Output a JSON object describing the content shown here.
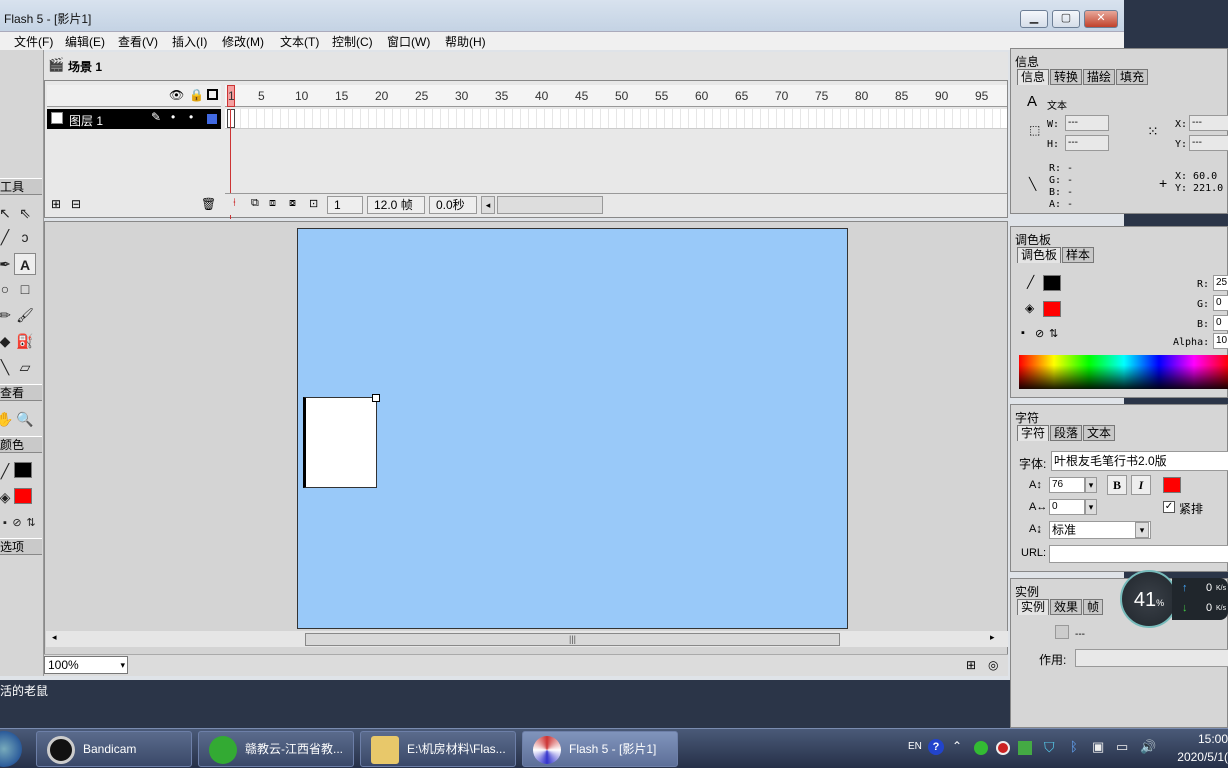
{
  "window": {
    "title": "Flash 5 - [影片1]"
  },
  "menu": [
    "文件(F)",
    "编辑(E)",
    "查看(V)",
    "插入(I)",
    "修改(M)",
    "文本(T)",
    "控制(C)",
    "窗口(W)",
    "帮助(H)"
  ],
  "scene": {
    "label": "场景 1"
  },
  "toolbox": {
    "tools_head": "工具",
    "view_head": "查看",
    "colors_head": "颜色",
    "options_head": "选项"
  },
  "timeline": {
    "layer_name": "图层 1",
    "ruler": [
      "1",
      "5",
      "10",
      "15",
      "20",
      "25",
      "30",
      "35",
      "40",
      "45",
      "50",
      "55",
      "60",
      "65",
      "70",
      "75",
      "80",
      "85",
      "90",
      "95"
    ],
    "current_frame": "1",
    "fps": "12.0 帧",
    "time": "0.0秒"
  },
  "status": {
    "zoom": "100%",
    "desktop_text": "活的老鼠"
  },
  "info_panel": {
    "title": "信息",
    "tabs": [
      "信息",
      "转换",
      "描绘",
      "填充"
    ],
    "type_label": "文本",
    "w_label": "W:",
    "h_label": "H:",
    "x_label": "X:",
    "y_label": "Y:",
    "w": "---",
    "h": "---",
    "x": "---",
    "y": "---",
    "rgba": [
      "R: -",
      "G: -",
      "B: -",
      "A: -"
    ],
    "mouse_x": "X: 60.0",
    "mouse_y": "Y: 221.0"
  },
  "mixer_panel": {
    "title": "调色板",
    "tabs": [
      "调色板",
      "样本"
    ],
    "r_label": "R:",
    "g_label": "G:",
    "b_label": "B:",
    "alpha_label": "Alpha:",
    "r": "25",
    "g": "0",
    "b": "0",
    "alpha": "10"
  },
  "char_panel": {
    "title": "字符",
    "tabs": [
      "字符",
      "段落",
      "文本"
    ],
    "font_label": "字体:",
    "font": "叶根友毛笔行书2.0版",
    "size": "76",
    "tracking": "0",
    "bold": "B",
    "italic": "I",
    "kern_label": "紧排",
    "baseline": "标准",
    "url_label": "URL:"
  },
  "instance_panel": {
    "title": "实例",
    "tabs": [
      "实例",
      "效果",
      "帧"
    ],
    "value": "---",
    "action_label": "作用:"
  },
  "netmeter": {
    "percent": "41",
    "unit": "%",
    "up": "0",
    "down": "0",
    "rate_unit": "K/s"
  },
  "taskbar": {
    "items": [
      "Bandicam",
      "赣教云-江西省教...",
      "E:\\机房材料\\Flas...",
      "Flash 5 - [影片1]"
    ],
    "lang": "EN",
    "time": "15:00",
    "date": "2020/5/1("
  },
  "colors": {
    "stage": "#99c9f9",
    "stroke": "#000000",
    "fill": "#ff0000"
  }
}
